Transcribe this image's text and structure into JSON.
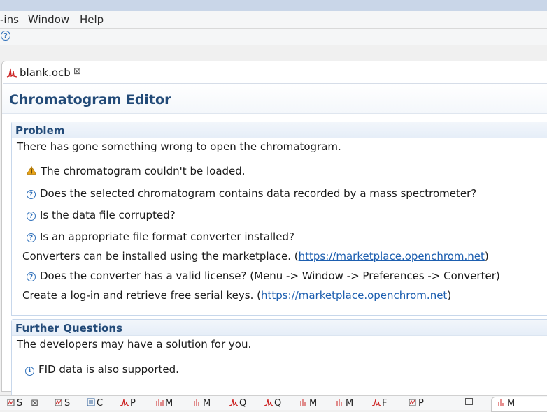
{
  "menubar": {
    "items": [
      "-ins",
      "Window",
      "Help"
    ]
  },
  "editor_tab": {
    "label": "blank.ocb",
    "close_glyph": "⊠"
  },
  "form": {
    "title": "Chromatogram Editor"
  },
  "problem": {
    "title": "Problem",
    "intro": "There has gone something wrong to open the chromatogram.",
    "warning": "The chromatogram couldn't be loaded.",
    "q1": "Does the selected chromatogram contains data recorded by a mass spectrometer?",
    "q2": "Is the data file corrupted?",
    "q3": "Is an appropriate file format converter installed?",
    "converters_text": "Converters can be installed using the marketplace. (",
    "marketplace_link": "https://marketplace.openchrom.net",
    "close_paren": ")",
    "q4": "Does the converter has a valid license? (Menu -> Window -> Preferences -> Converter)",
    "login_text": "Create a log-in and retrieve free serial keys. (",
    "login_link": "https://marketplace.openchrom.net",
    "login_close": ")"
  },
  "further": {
    "title": "Further Questions",
    "intro": "The developers may have a solution for you.",
    "info": "FID data is also supported."
  },
  "bottom_tabs": [
    "S",
    "S",
    "C",
    "P",
    "M",
    "M",
    "Q",
    "Q",
    "M",
    "M",
    "F",
    "P"
  ],
  "right_panel_tab": "M",
  "colors": {
    "accent": "#224a78",
    "link": "#1d5fb0",
    "icon_blue": "#2d6fba",
    "warning": "#e8a317"
  }
}
